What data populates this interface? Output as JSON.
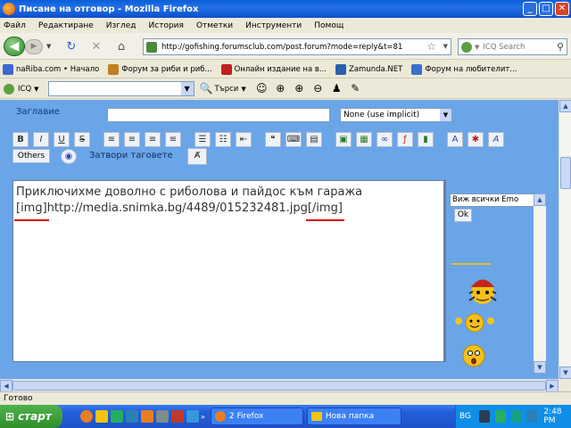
{
  "window": {
    "title": "Писане на отговор - Mozilla Firefox"
  },
  "menu": [
    "Файл",
    "Редактиране",
    "Изглед",
    "История",
    "Отметки",
    "Инструменти",
    "Помощ"
  ],
  "nav": {
    "url": "http://gofishing.forumsclub.com/post.forum?mode=reply&t=81",
    "search_placeholder": "ICQ Search"
  },
  "bookmarks": [
    {
      "label": "naRiba.com • Начало",
      "color": "#3a6ad0"
    },
    {
      "label": "Форум за риби и риб...",
      "color": "#c08020"
    },
    {
      "label": "Онлайн издание на в...",
      "color": "#c02020"
    },
    {
      "label": "Zamunda.NET",
      "color": "#2a60b0"
    },
    {
      "label": "Форум на любителит...",
      "color": "#3a70d0"
    }
  ],
  "icq": {
    "label": "ICQ",
    "search_label": "Търси"
  },
  "editor": {
    "title_label": "Заглавие",
    "title_value": "",
    "font_select": "None (use implicit)",
    "format_buttons": [
      "B",
      "I",
      "U",
      "S"
    ],
    "others_label": "Others",
    "close_tags_label": "Затвори таговете",
    "body_line1": "Приключихме доволно с риболова и пайдос към гаража",
    "tag_open": "[img]",
    "url": "http://media.snimka.bg/4489/015232481.jpg",
    "tag_close": "[/img]"
  },
  "emoticons": {
    "select_label": "Виж всички Emo",
    "ok_label": "Ok"
  },
  "status": {
    "text": "Готово"
  },
  "taskbar": {
    "start_label": "старт",
    "tasks": [
      "2 Firefox",
      "Нова папка"
    ],
    "lang": "BG",
    "clock": "2:48 PM"
  }
}
